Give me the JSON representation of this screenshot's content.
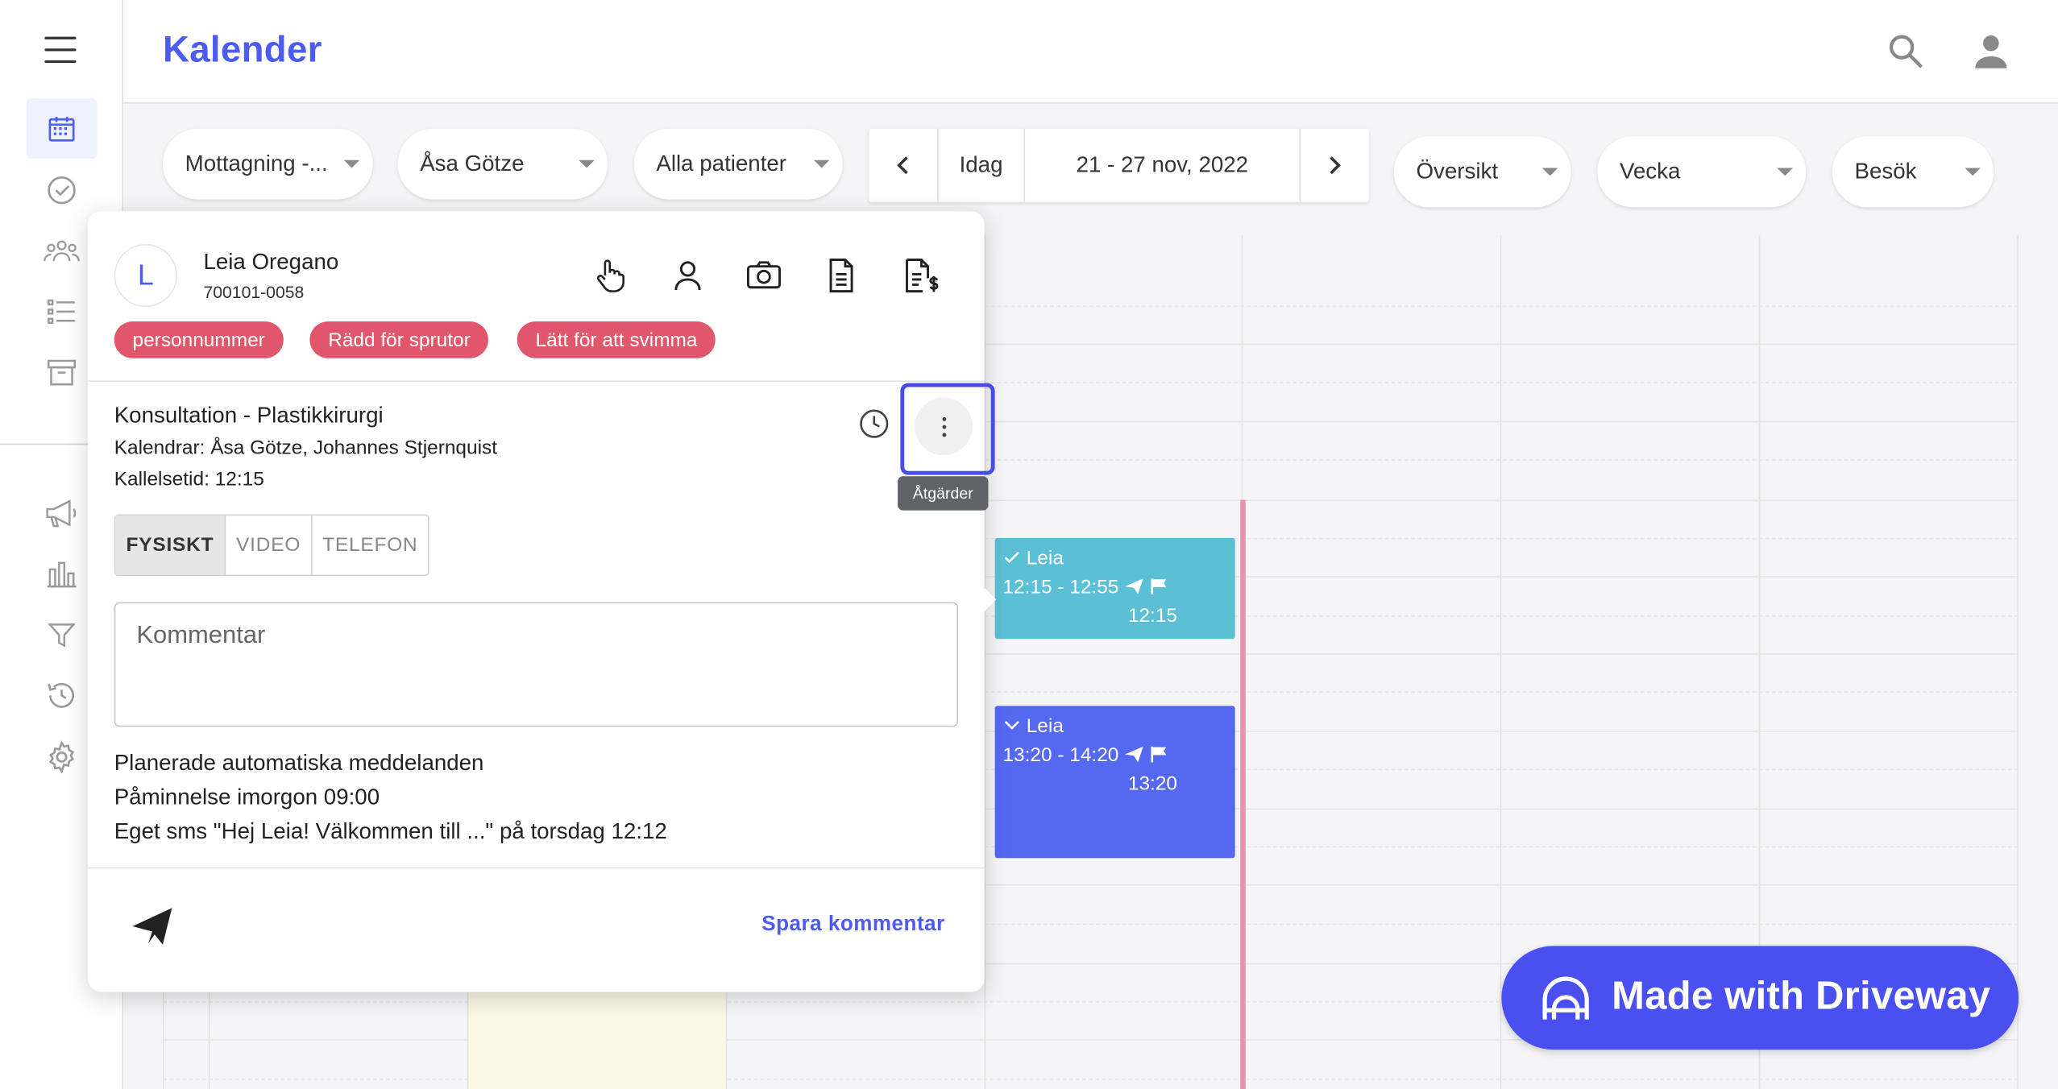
{
  "header": {
    "title": "Kalender"
  },
  "toolbar": {
    "filter_location": "Mottagning -...",
    "filter_staff": "Åsa Götze",
    "filter_patients": "Alla patienter",
    "today_label": "Idag",
    "date_range": "21 - 27 nov, 2022",
    "view_overview": "Översikt",
    "view_period": "Vecka",
    "view_type": "Besök"
  },
  "patient": {
    "initial": "L",
    "name": "Leia Oregano",
    "id_number": "700101-0058",
    "tags": [
      "personnummer",
      "Rädd för sprutor",
      "Lätt för att svimma"
    ]
  },
  "appointment": {
    "title": "Konsultation - Plastikkirurgi",
    "calendars": "Kalendrar: Åsa Götze, Johannes Stjernquist",
    "call_time": "Kallelsetid: 12:15",
    "modes": [
      "FYSISKT",
      "VIDEO",
      "TELEFON"
    ],
    "active_mode": "FYSISKT",
    "comment_placeholder": "Kommentar",
    "actions_tooltip": "Åtgärder"
  },
  "messages": {
    "heading": "Planerade automatiska meddelanden",
    "reminder": "Påminnelse imorgon 09:00",
    "sms": "Eget sms \"Hej Leia! Välkommen till ...\" på torsdag 12:12"
  },
  "footer": {
    "save_label": "Spara kommentar"
  },
  "events": [
    {
      "name": "Leia",
      "time": "12:15 - 12:55",
      "call": "12:15",
      "color": "#5bc0d6"
    },
    {
      "name": "Leia",
      "time": "13:20 - 14:20",
      "call": "13:20",
      "color": "#5568f0"
    }
  ],
  "badge": {
    "label": "Made with Driveway"
  },
  "colors": {
    "accent": "#4c5cf0",
    "tag": "#e0566a",
    "now_line": "#e890ae"
  }
}
